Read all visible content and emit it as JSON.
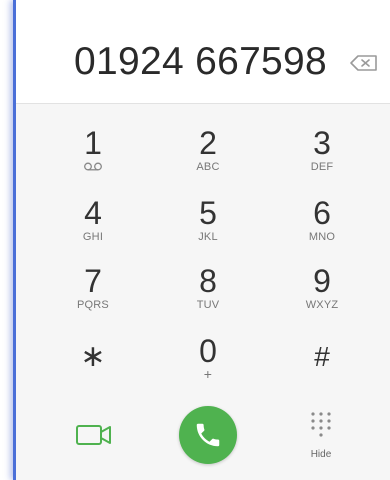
{
  "display": {
    "number": "01924 667598"
  },
  "keys": [
    {
      "digit": "1",
      "letters": "",
      "icon": "voicemail-icon"
    },
    {
      "digit": "2",
      "letters": "ABC"
    },
    {
      "digit": "3",
      "letters": "DEF"
    },
    {
      "digit": "4",
      "letters": "GHI"
    },
    {
      "digit": "5",
      "letters": "JKL"
    },
    {
      "digit": "6",
      "letters": "MNO"
    },
    {
      "digit": "7",
      "letters": "PQRS"
    },
    {
      "digit": "8",
      "letters": "TUV"
    },
    {
      "digit": "9",
      "letters": "WXYZ"
    },
    {
      "digit": "∗",
      "letters": ""
    },
    {
      "digit": "0",
      "letters": "+"
    },
    {
      "digit": "#",
      "letters": ""
    }
  ],
  "actions": {
    "video_icon": "video-call-icon",
    "call_icon": "phone-icon",
    "hide_icon": "keypad-grid-icon",
    "hide_label": "Hide"
  },
  "colors": {
    "call_green": "#4fb24f",
    "video_green": "#4fb24f",
    "frame_blue": "#4a6fd8"
  }
}
